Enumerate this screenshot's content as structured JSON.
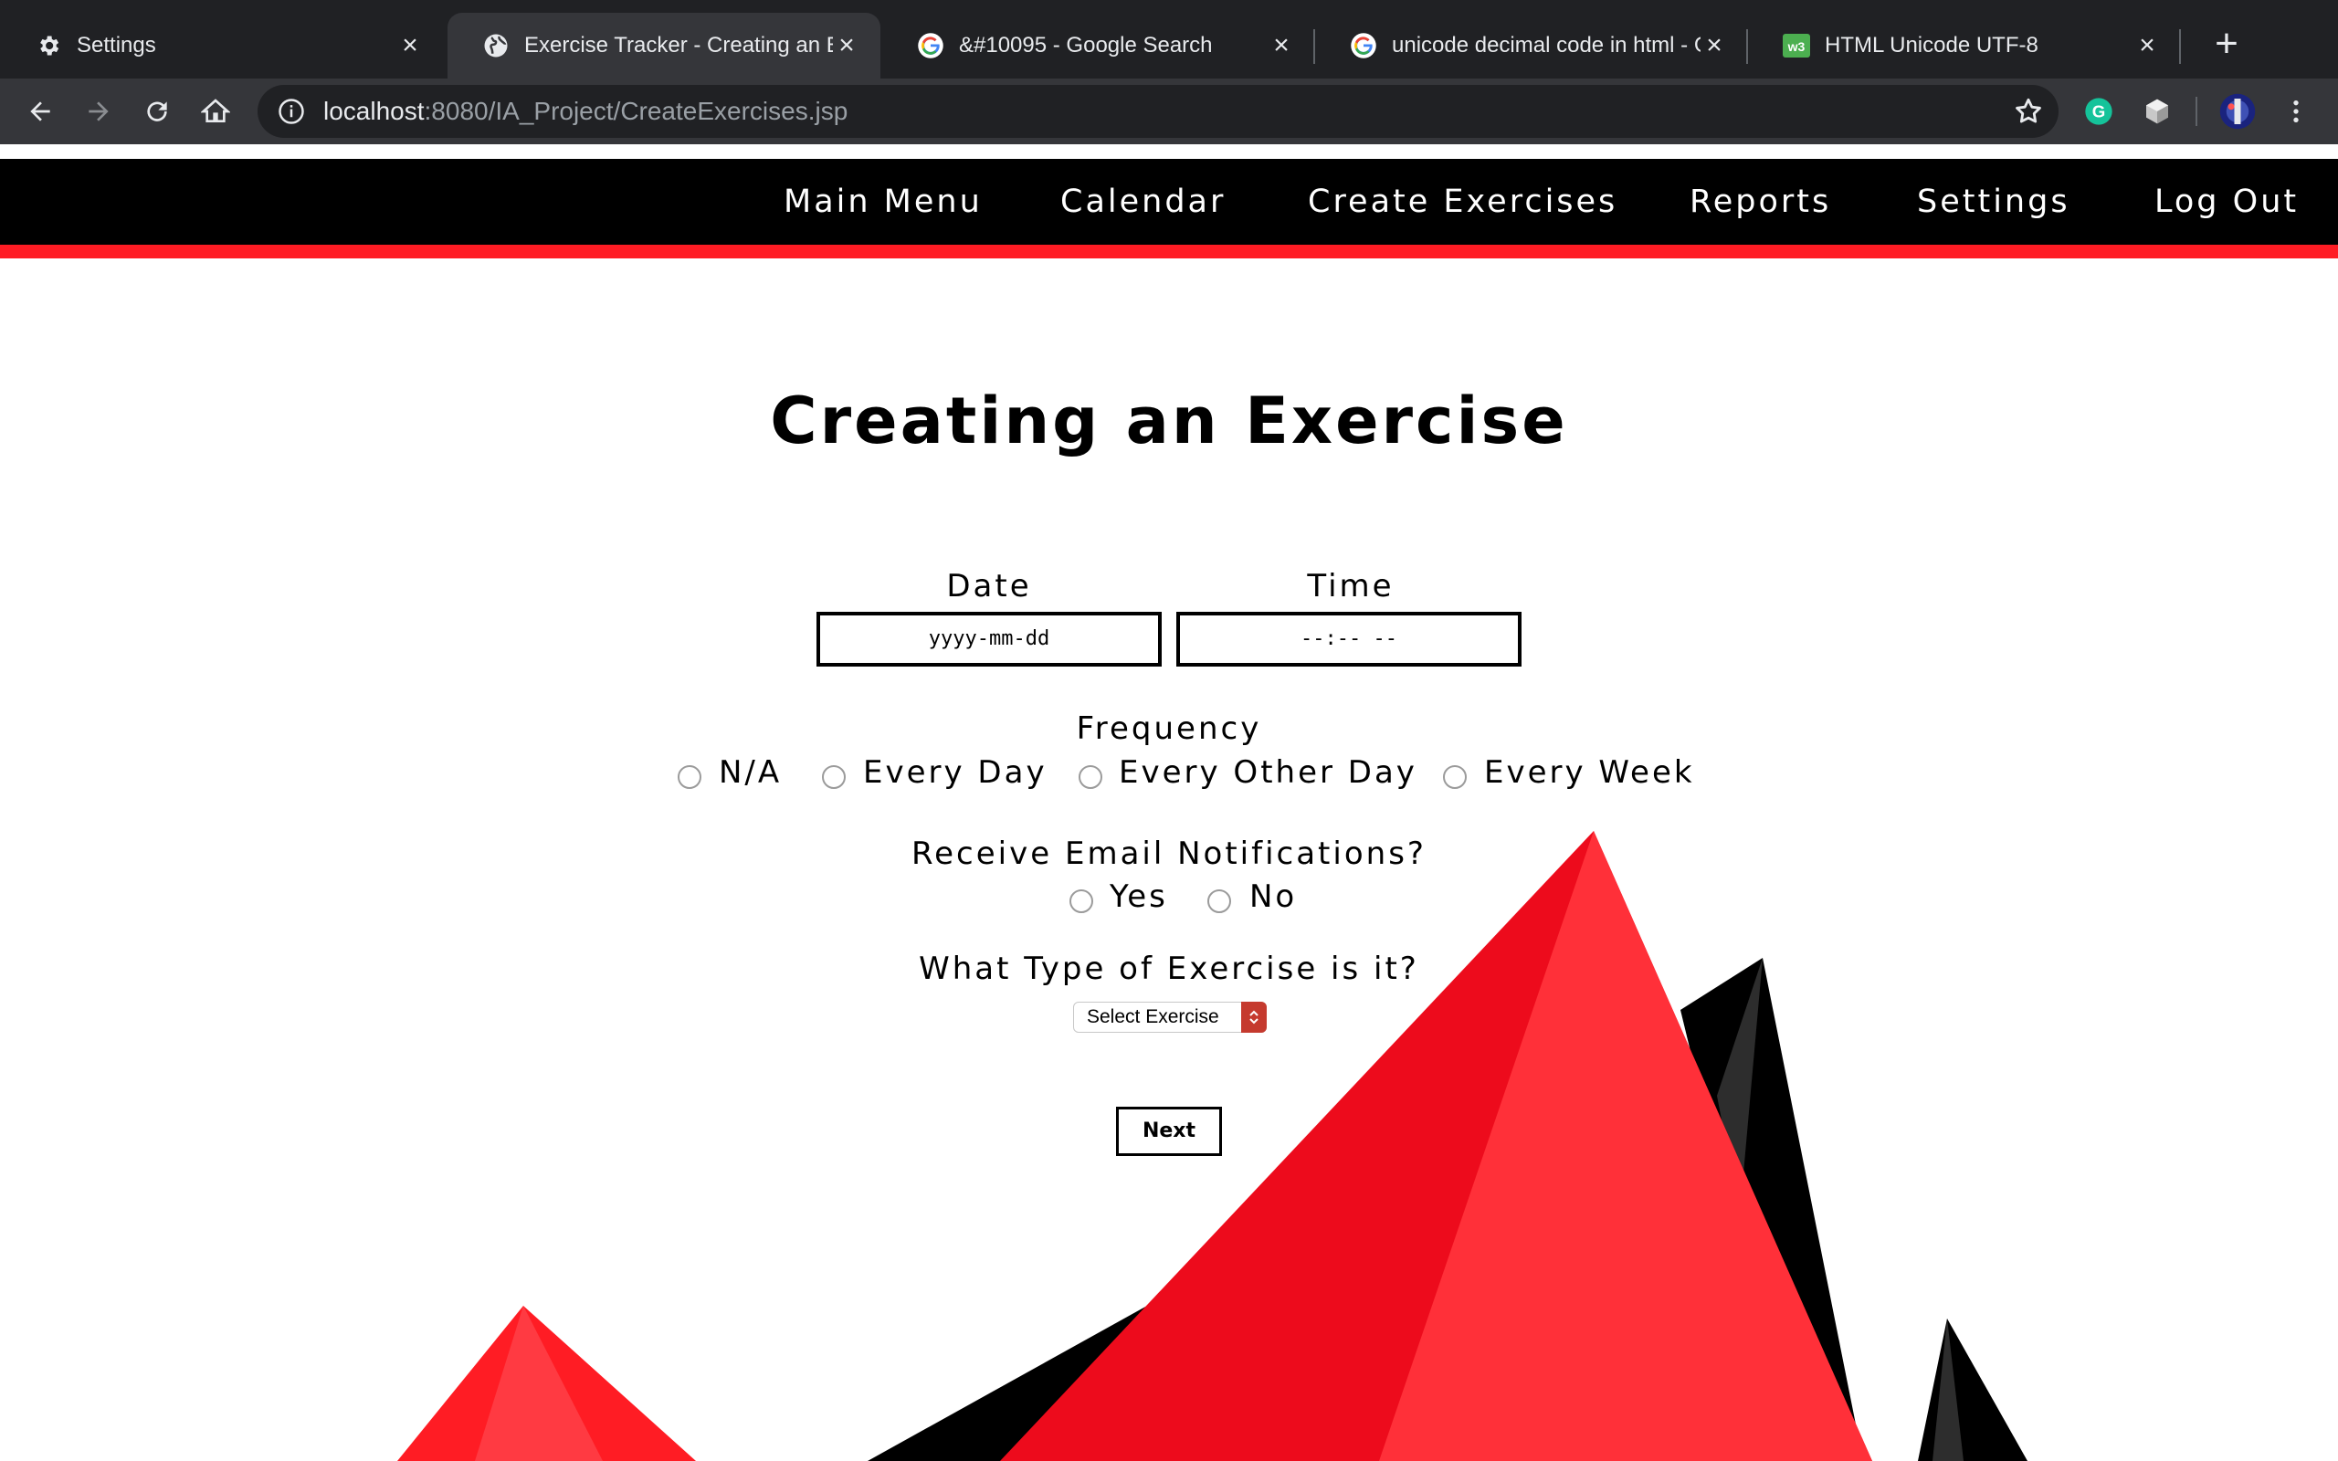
{
  "browser": {
    "tabs": [
      {
        "title": "Settings",
        "icon": "gear-icon",
        "active": false
      },
      {
        "title": "Exercise Tracker - Creating an Exercise",
        "icon": "globe-icon",
        "active": true
      },
      {
        "title": "&#10095 - Google Search",
        "icon": "google-icon",
        "active": false
      },
      {
        "title": "unicode decimal code in html - Google Search",
        "icon": "google-icon",
        "active": false
      },
      {
        "title": "HTML Unicode UTF-8",
        "icon": "w3schools-icon",
        "active": false
      }
    ],
    "url_host": "localhost",
    "url_path": ":8080/IA_Project/CreateExercises.jsp"
  },
  "nav": {
    "items": [
      "Main Menu",
      "Calendar",
      "Create Exercises",
      "Reports",
      "Settings",
      "Log Out"
    ]
  },
  "form": {
    "title": "Creating an Exercise",
    "date_label": "Date",
    "date_value": "yyyy-mm-dd",
    "time_label": "Time",
    "time_value": "--:-- --",
    "frequency_label": "Frequency",
    "frequency_options": [
      "N/A",
      "Every Day",
      "Every Other Day",
      "Every Week"
    ],
    "email_label": "Receive Email Notifications?",
    "email_options": [
      "Yes",
      "No"
    ],
    "type_label": "What Type of Exercise is it?",
    "type_select": "Select Exercise",
    "next_label": "Next"
  },
  "colors": {
    "accent_red": "#ff1c24",
    "nav_bg": "#000000",
    "chrome_dark": "#202124",
    "chrome_toolbar": "#35363a"
  }
}
